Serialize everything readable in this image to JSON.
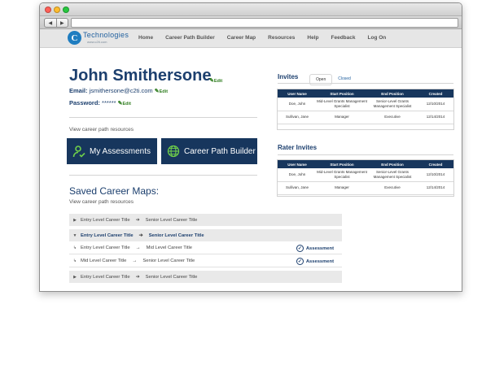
{
  "browser": {
    "back": "◀",
    "forward": "▶"
  },
  "logo": {
    "mark": "C",
    "name": "Technologies",
    "url": "www.c2ti.com"
  },
  "nav": [
    "Home",
    "Career Path Builder",
    "Career Map",
    "Resources",
    "Help",
    "Feedback",
    "Log On"
  ],
  "profile": {
    "name": "John Smithersone",
    "email_label": "Email:",
    "email": "jsmithersone@c2ti.com",
    "password_label": "Password:",
    "password": "******",
    "edit": "Edit"
  },
  "resources_link": "View career path resources",
  "buttons": {
    "assessments": "My Assessments",
    "builder": "Career Path Builder"
  },
  "saved": {
    "title": "Saved Career Maps:",
    "subtitle": "View career path resources",
    "rows": [
      {
        "from": "Entry Level Career Title",
        "to": "Senior Level Career Title"
      },
      {
        "from": "Entry Level Career Title",
        "to": "Senior Level Career Title"
      },
      {
        "from": "Entry Level Career Title",
        "to": "Mid Level Career Title",
        "action": "Assessment"
      },
      {
        "from": "Mid Level Career Title",
        "to": "Senior Level Career Title",
        "action": "Assessment"
      },
      {
        "from": "Entry Level Career Title",
        "to": "Senior Level Career Title"
      }
    ]
  },
  "invites": {
    "title": "Invites",
    "tabs": [
      "Open",
      "Closed"
    ],
    "columns": [
      "User Name",
      "Start Position",
      "End Position",
      "Created"
    ],
    "rows": [
      [
        "Doe, John",
        "Mid-Level Grants Management Specialist",
        "Senior-Level Grants Management Specialist",
        "12/10/2014"
      ],
      [
        "Sullivan, Jane",
        "Manager",
        "Executive",
        "12/14/2014"
      ]
    ]
  },
  "rater_invites": {
    "title": "Rater Invites",
    "columns": [
      "User Name",
      "Start Position",
      "End Position",
      "Created"
    ],
    "rows": [
      [
        "Doe, John",
        "Mid-Level Grants Management Specialist",
        "Senior-Level Grants Management Specialist",
        "12/10/2014"
      ],
      [
        "Sullivan, Jane",
        "Manager",
        "Executive",
        "12/14/2014"
      ]
    ]
  },
  "colors": {
    "navy": "#17365d",
    "title": "#1c3f6e",
    "edit_green": "#2f7d1f"
  }
}
